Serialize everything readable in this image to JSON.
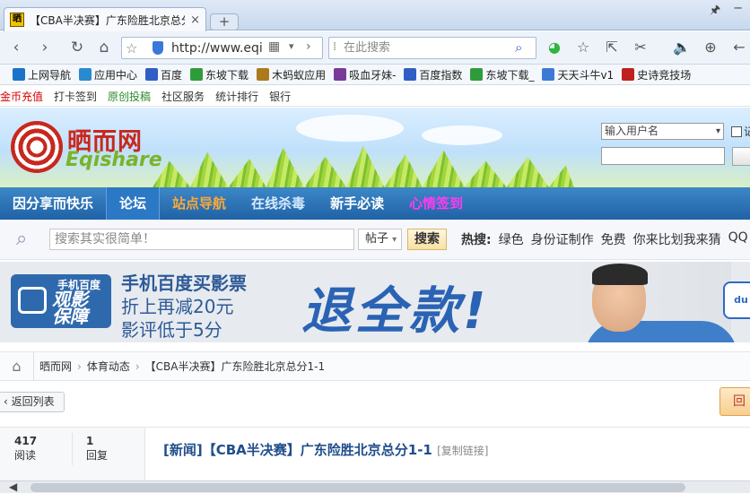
{
  "browser": {
    "tab": {
      "favicon_text": "晒",
      "title": "【CBA半决赛】广东险胜北京总分",
      "close": "×"
    },
    "new_tab": "+",
    "url": "http://www.eqi",
    "search_placeholder": "在此搜索",
    "nav": {
      "back": "‹",
      "forward": "›",
      "reload": "↻",
      "home": "⌂"
    },
    "toolbar_icons": [
      "wechat-icon",
      "star-icon",
      "share-icon",
      "cut-icon",
      "speaker-icon",
      "download-icon",
      "back-arrow-icon"
    ]
  },
  "bookmarks": [
    {
      "label": "上网导航",
      "icon": "ie-icon",
      "color": "#1a73c8"
    },
    {
      "label": "应用中心",
      "icon": "app-icon",
      "color": "#2a8ad0"
    },
    {
      "label": "百度",
      "icon": "baidu-icon",
      "color": "#2f5ec5"
    },
    {
      "label": "东坡下载",
      "icon": "dongpo-icon",
      "color": "#2f9c3b"
    },
    {
      "label": "木蚂蚁应用",
      "icon": "ant-icon",
      "color": "#ab7a1c"
    },
    {
      "label": "吸血牙妹-",
      "icon": "vamp-icon",
      "color": "#7a3a9a"
    },
    {
      "label": "百度指数",
      "icon": "baidu-icon",
      "color": "#2f5ec5"
    },
    {
      "label": "东坡下载_",
      "icon": "dongpo-icon",
      "color": "#2f9c3b"
    },
    {
      "label": "天天斗牛v1",
      "icon": "doc-icon",
      "color": "#3d7ad8"
    },
    {
      "label": "史诗竞技场",
      "icon": "game-icon",
      "color": "#c21f1f"
    }
  ],
  "site": {
    "top_links": [
      {
        "label": "金币充值",
        "style": "red"
      },
      {
        "label": "打卡签到",
        "style": "normal"
      },
      {
        "label": "原创投稿",
        "style": "green"
      },
      {
        "label": "社区服务",
        "style": "normal"
      },
      {
        "label": "统计排行",
        "style": "normal"
      },
      {
        "label": "银行",
        "style": "normal"
      }
    ],
    "logo_cn": "晒而网",
    "logo_en": "Eqishare",
    "login": {
      "user_select": "输入用户名",
      "checkbox_label": "记"
    },
    "nav": [
      {
        "label": "因分享而快乐",
        "style": ""
      },
      {
        "label": "论坛",
        "style": "active"
      },
      {
        "label": "站点导航",
        "style": "orange"
      },
      {
        "label": "在线杀毒",
        "style": "lblue"
      },
      {
        "label": "新手必读",
        "style": ""
      },
      {
        "label": "心情签到",
        "style": "magenta"
      }
    ],
    "search": {
      "placeholder": "搜索其实很简单！",
      "type": "帖子",
      "button": "搜索",
      "hot_label": "热搜:",
      "hot": [
        "绿色",
        "身份证制作",
        "免费",
        "你来比划我来猜",
        "QQ"
      ]
    },
    "ad": {
      "badge_line1": "手机百度",
      "badge_line2": "观影\n保障",
      "line1": "手机百度买影票",
      "line2": "折上再减20元",
      "line3": "影评低于5分",
      "big": "退全款!",
      "logo": "du"
    },
    "breadcrumb": [
      "晒而网",
      "体育动态",
      "【CBA半决赛】广东险胜北京总分1-1"
    ],
    "back_button": "‹ 返回列表",
    "reply_button": "回",
    "post": {
      "views_num": "417",
      "views_label": "阅读",
      "replies_num": "1",
      "replies_label": "回复",
      "title": "[新闻]【CBA半决赛】广东险胜北京总分1-1",
      "copy_link": "[复制链接]"
    }
  }
}
